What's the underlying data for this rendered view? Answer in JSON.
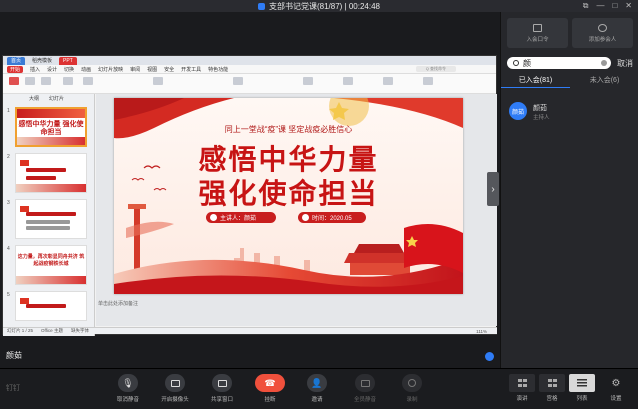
{
  "titlebar": {
    "title": "支部书记党课(81/87) | 00:24:48"
  },
  "wps": {
    "tabs": [
      "首页",
      "稻壳模板",
      "PPT"
    ],
    "menu": [
      "开始",
      "插入",
      "设计",
      "切换",
      "动画",
      "幻灯片放映",
      "审阅",
      "视图",
      "安全",
      "开发工具",
      "特色功能"
    ],
    "search_placeholder": "Q 查找命令",
    "panel_tabs": [
      "大纲",
      "幻灯片"
    ],
    "notes": "单击此处添加备注",
    "status_left": "幻灯片 1 / 25",
    "status_theme": "Office 主题",
    "status_missing": "缺失字体",
    "zoom": "111%"
  },
  "slide": {
    "subtitle": "同上一堂战“疫”课 坚定战疫必胜信心",
    "title_line1": "感悟中华力量",
    "title_line2": "强化使命担当",
    "presenter": "主讲人：颜茹",
    "time": "时间：2020.05"
  },
  "thumbs": [
    {
      "num": "1",
      "text": "感悟中华力量 强化使命担当"
    },
    {
      "num": "2",
      "text": ""
    },
    {
      "num": "3",
      "text": ""
    },
    {
      "num": "4",
      "text": "这力量，再次彰显同舟共济 筑起战疫钢铁长城"
    },
    {
      "num": "5",
      "text": ""
    }
  ],
  "stage": {
    "presenter_name": "颜茹"
  },
  "right": {
    "actions": [
      "入会口令",
      "添加参会人"
    ],
    "search_value": "颜",
    "cancel": "取消",
    "tab_in": "已入会(81)",
    "tab_out": "未入会(6)",
    "member": {
      "avatar": "颜茹",
      "name": "颜茹",
      "role": "主持人"
    }
  },
  "toolbar": {
    "logo": "钉钉",
    "buttons": [
      "取消静音",
      "开启摄像头",
      "共享窗口",
      "挂断",
      "邀请",
      "全员静音",
      "录制"
    ],
    "right_buttons": [
      "演讲",
      "宫格",
      "列表",
      "设置"
    ]
  },
  "colors": {
    "accent": "#2f7cf6",
    "hangup": "#f0503c",
    "slide_red": "#c71414"
  }
}
